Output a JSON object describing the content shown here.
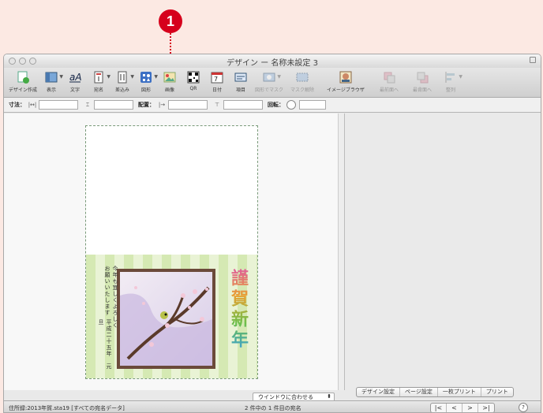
{
  "callout": "1",
  "window": {
    "title": "デザイン ー 名称未設定 3"
  },
  "toolbar": {
    "design": "デザイン作成",
    "view": "表示",
    "text": "文字",
    "address": "宛名",
    "insert": "差込み",
    "shape": "図形",
    "image": "画像",
    "qr": "QR",
    "date": "日付",
    "item": "項目",
    "mask": "図形でマスク",
    "unmask": "マスク解除",
    "browser": "イメージブラウザ",
    "front": "最前面へ",
    "back": "最背面へ",
    "align": "整列"
  },
  "propbar": {
    "size": "寸法：",
    "place": "配置：",
    "rotate": "回転："
  },
  "card": {
    "greeting": "今年も宜しくよろしくお願いいたします",
    "date": "平成二十五年　元旦",
    "kinga": "謹賀新年"
  },
  "fit_select": "ウインドウに合わせる",
  "settings": {
    "design": "デザイン設定",
    "page": "ページ設定",
    "single": "一枚プリント",
    "print": "プリント"
  },
  "status": {
    "file": "住所録:2013年賀.sta19 [すべての宛名データ]",
    "count": "2 件中の 1 件目の宛名",
    "nav_first": "|<",
    "nav_prev": "<",
    "nav_next": ">",
    "nav_last": ">|",
    "help": "?"
  }
}
